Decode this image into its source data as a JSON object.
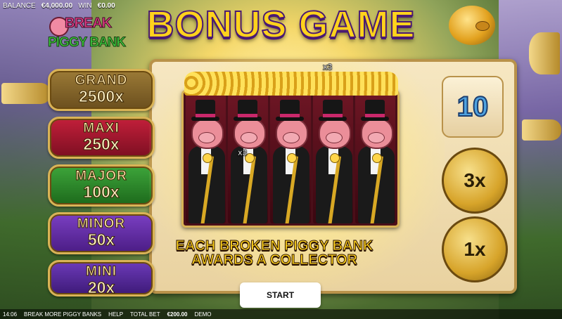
{
  "topbar": {
    "balance_label": "BALANCE",
    "balance_value": "€4,000.00",
    "win_label": "WIN",
    "win_value": "€0.00"
  },
  "logo": {
    "line1": "BREAK",
    "line2": "PIGGY BANK"
  },
  "title": "BONUS GAME",
  "jackpots": [
    {
      "name": "GRAND",
      "value": "2500x"
    },
    {
      "name": "MAXI",
      "value": "250x"
    },
    {
      "name": "MAJOR",
      "value": "100x"
    },
    {
      "name": "MINOR",
      "value": "50x"
    },
    {
      "name": "MINI",
      "value": "20x"
    }
  ],
  "board": {
    "tile_top_value": "10",
    "collector_mid": "3x",
    "collector_bottom": "1x",
    "reel_multiplier_top": "x3",
    "reel_multiplier_mid": "x3"
  },
  "message": {
    "line1": "EACH BROKEN PIGGY BANK",
    "line2": "AWARDS A COLLECTOR"
  },
  "start_label": "START",
  "bottombar": {
    "time": "14:06",
    "game_name": "BREAK MORE PIGGY BANKS",
    "help": "HELP",
    "total_bet_label": "TOTAL BET",
    "total_bet_value": "€200.00",
    "mode": "DEMO"
  }
}
